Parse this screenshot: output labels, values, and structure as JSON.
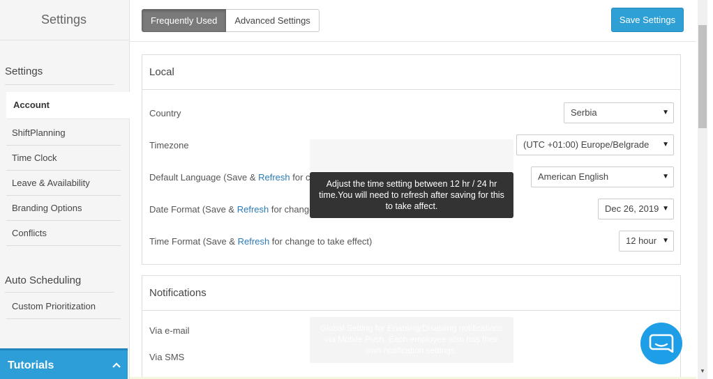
{
  "sidebar": {
    "title": "Settings",
    "section_settings": "Settings",
    "items": [
      {
        "label": "Account"
      },
      {
        "label": "ShiftPlanning"
      },
      {
        "label": "Time Clock"
      },
      {
        "label": "Leave & Availability"
      },
      {
        "label": "Branding Options"
      },
      {
        "label": "Conflicts"
      }
    ],
    "section_auto": "Auto Scheduling",
    "auto_items": [
      {
        "label": "Custom Prioritization"
      }
    ],
    "tutorials_label": "Tutorials",
    "tutorials_icon": "chevron-up-icon"
  },
  "tabs": {
    "frequently_used": "Frequently Used",
    "advanced_settings": "Advanced Settings"
  },
  "save_label": "Save Settings",
  "local": {
    "heading": "Local",
    "country_label": "Country",
    "country_value": "Serbia",
    "timezone_label": "Timezone",
    "timezone_value": "(UTC +01:00) Europe/Belgrade",
    "language_label_pre": "Default Language (Save & ",
    "language_label_link": "Refresh",
    "language_label_post": " for ch",
    "language_value": "American English",
    "date_label_pre": "Date Format (Save & ",
    "date_label_link": "Refresh",
    "date_label_post": " for change",
    "date_value": "Dec 26, 2019",
    "time_label_pre": "Time Format (Save & ",
    "time_label_link": "Refresh",
    "time_label_post": " for change to take effect)",
    "time_value": "12 hour"
  },
  "tooltip": "Adjust the time setting between 12 hr / 24 hr time.You will need to refresh after saving for this to take affect.",
  "ghost_tooltip_1": "Global Setting for Enabling/Disabling notifications via Mobile Push. Each employee also has their own notification settings.",
  "notifications": {
    "heading": "Notifications",
    "email_label": "Via e-mail",
    "sms_label": "Via SMS"
  },
  "colors": {
    "accent": "#2ea0d6",
    "chat": "#1f9ee8"
  }
}
